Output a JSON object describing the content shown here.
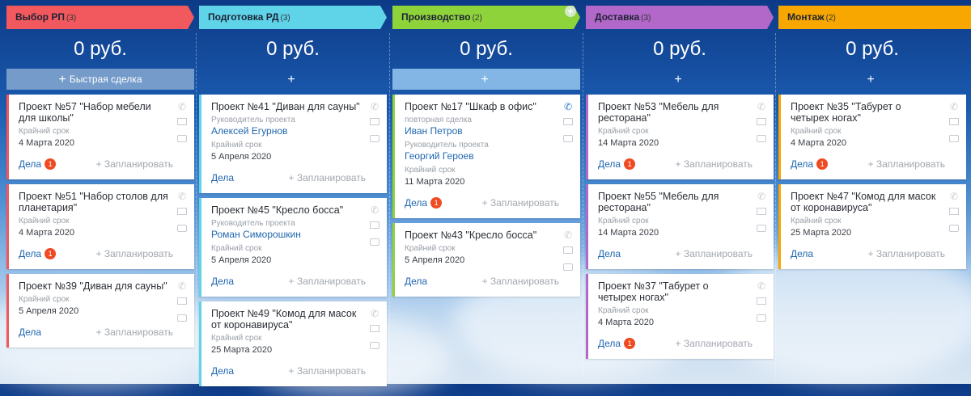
{
  "stages": [
    {
      "name": "Выбор РП",
      "count": "(3)",
      "color": "#f2595e",
      "sum": "0 руб.",
      "quick_label": "Быстрая сделка",
      "quick_plus": "+",
      "cards": [
        {
          "title": "Проект №57 \"Набор мебели для школы\"",
          "rows": [
            {
              "label": "Крайний срок"
            },
            {
              "date": "4 Марта 2020"
            }
          ],
          "deals": "Дела",
          "badge": "1",
          "plan": "+ Запланировать",
          "border": "#f2595e"
        },
        {
          "title": "Проект №51 \"Набор столов для планетария\"",
          "rows": [
            {
              "label": "Крайний срок"
            },
            {
              "date": "4 Марта 2020"
            }
          ],
          "deals": "Дела",
          "badge": "1",
          "plan": "+ Запланировать",
          "border": "#f2595e"
        },
        {
          "title": "Проект №39 \"Диван для сауны\"",
          "rows": [
            {
              "label": "Крайний срок"
            },
            {
              "date": "5 Апреля 2020"
            }
          ],
          "deals": "Дела",
          "badge": "",
          "plan": "+ Запланировать",
          "border": "#f2595e"
        }
      ]
    },
    {
      "name": "Подготовка РД",
      "count": "(3)",
      "color": "#5fd3e8",
      "sum": "0 руб.",
      "quick_label": "",
      "quick_plus": "+",
      "cards": [
        {
          "title": "Проект №41 \"Диван для сауны\"",
          "rows": [
            {
              "label": "Руководитель проекта"
            },
            {
              "person": "Алексей Егурнов"
            },
            {
              "label": "Крайний срок"
            },
            {
              "date": "5 Апреля 2020"
            }
          ],
          "deals": "Дела",
          "badge": "",
          "plan": "+ Запланировать",
          "border": "#5fd3e8"
        },
        {
          "title": "Проект №45 \"Кресло босса\"",
          "rows": [
            {
              "label": "Руководитель проекта"
            },
            {
              "person": "Роман Симорошкин"
            },
            {
              "label": "Крайний срок"
            },
            {
              "date": "5 Апреля 2020"
            }
          ],
          "deals": "Дела",
          "badge": "",
          "plan": "+ Запланировать",
          "border": "#5fd3e8"
        },
        {
          "title": "Проект №49 \"Комод для масок от коронавируса\"",
          "rows": [
            {
              "label": "Крайний срок"
            },
            {
              "date": "25 Марта 2020"
            }
          ],
          "deals": "Дела",
          "badge": "",
          "plan": "+ Запланировать",
          "border": "#5fd3e8"
        }
      ]
    },
    {
      "name": "Производство",
      "count": "(2)",
      "color": "#8fd33b",
      "sum": "0 руб.",
      "quick_label": "",
      "quick_plus": "+",
      "cards": [
        {
          "title": "Проект №17 \"Шкаф в офис\"",
          "rows": [
            {
              "label": "повторная сделка"
            },
            {
              "person": "Иван Петров"
            },
            {
              "label": "Руководитель проекта"
            },
            {
              "person": "Георгий Героев"
            },
            {
              "label": "Крайний срок"
            },
            {
              "date": "11 Марта 2020"
            }
          ],
          "deals": "Дела",
          "badge": "1",
          "plan": "+ Запланировать",
          "border": "#8fd33b",
          "phone_active": true
        },
        {
          "title": "Проект №43 \"Кресло босса\"",
          "rows": [
            {
              "label": "Крайний срок"
            },
            {
              "date": "5 Апреля 2020"
            }
          ],
          "deals": "Дела",
          "badge": "",
          "plan": "+ Запланировать",
          "border": "#8fd33b"
        }
      ]
    },
    {
      "name": "Доставка",
      "count": "(3)",
      "color": "#b168c9",
      "sum": "0 руб.",
      "quick_label": "",
      "quick_plus": "+",
      "cards": [
        {
          "title": "Проект №53 \"Мебель для ресторана\"",
          "rows": [
            {
              "label": "Крайний срок"
            },
            {
              "date": "14 Марта 2020"
            }
          ],
          "deals": "Дела",
          "badge": "1",
          "plan": "+ Запланировать",
          "border": "#b168c9"
        },
        {
          "title": "Проект №55 \"Мебель для ресторана\"",
          "rows": [
            {
              "label": "Крайний срок"
            },
            {
              "date": "14 Марта 2020"
            }
          ],
          "deals": "Дела",
          "badge": "",
          "plan": "+ Запланировать",
          "border": "#b168c9"
        },
        {
          "title": "Проект №37 \"Табурет о четырех ногах\"",
          "rows": [
            {
              "label": "Крайний срок"
            },
            {
              "date": "4 Марта 2020"
            }
          ],
          "deals": "Дела",
          "badge": "1",
          "plan": "+ Запланировать",
          "border": "#b168c9"
        }
      ]
    },
    {
      "name": "Монтаж",
      "count": "(2)",
      "color": "#f7a700",
      "sum": "0 руб.",
      "quick_label": "",
      "quick_plus": "+",
      "cards": [
        {
          "title": "Проект №35 \"Табурет о четырех ногах\"",
          "rows": [
            {
              "label": "Крайний срок"
            },
            {
              "date": "4 Марта 2020"
            }
          ],
          "deals": "Дела",
          "badge": "1",
          "plan": "+ Запланировать",
          "border": "#f7a700"
        },
        {
          "title": "Проект №47 \"Комод для масок от коронавируса\"",
          "rows": [
            {
              "label": "Крайний срок"
            },
            {
              "date": "25 Марта 2020"
            }
          ],
          "deals": "Дела",
          "badge": "",
          "plan": "+ Запланировать",
          "border": "#f7a700"
        }
      ]
    }
  ]
}
